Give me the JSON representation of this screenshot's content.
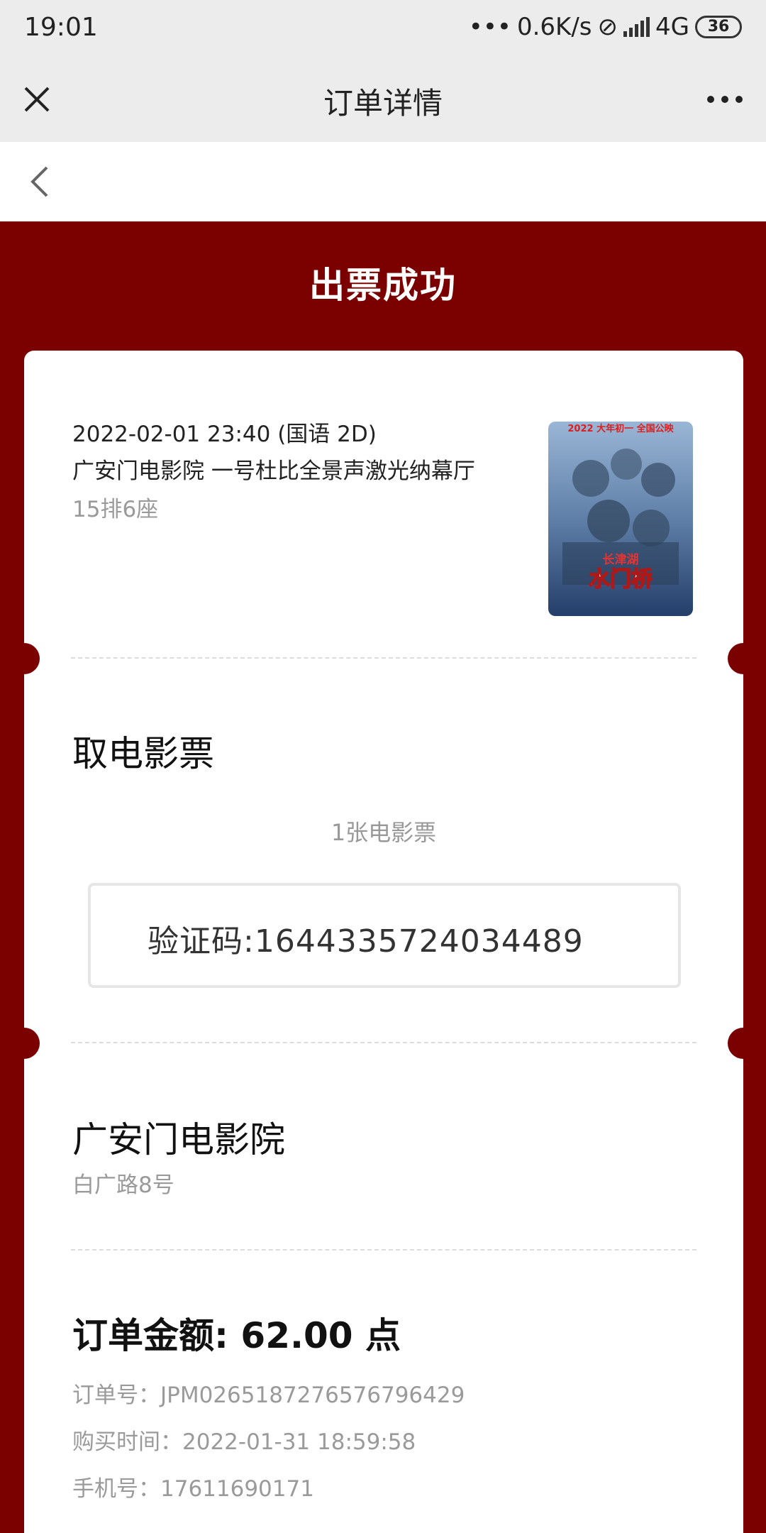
{
  "status_bar": {
    "time": "19:01",
    "network_speed": "0.6K/s",
    "network_type": "4G",
    "battery": "36"
  },
  "title_bar": {
    "title": "订单详情",
    "close_icon": "close-icon",
    "more_icon": "more-icon"
  },
  "nav": {
    "back_icon": "back-icon"
  },
  "order": {
    "status": "出票成功",
    "showtime": "2022-02-01 23:40 (国语 2D)",
    "cinema_hall": "广安门电影院 一号杜比全景声激光纳幕厅",
    "seat": "15排6座",
    "poster": {
      "top_text": "2022 大年初一 全国公映",
      "subtitle": "长津湖",
      "title": "水门桥"
    }
  },
  "pickup": {
    "heading": "取电影票",
    "ticket_count": "1张电影票",
    "code_label": "验证码:",
    "code": "1644335724034489"
  },
  "cinema": {
    "name": "广安门电影院",
    "address": "白广路8号"
  },
  "payment": {
    "amount_label": "订单金额",
    "amount_sep": ": ",
    "amount": "62.00",
    "unit": "点",
    "order_no_label": "订单号：",
    "order_no": "JPM0265187276576796429",
    "purchase_time_label": "购买时间：",
    "purchase_time": "2022-01-31 18:59:58",
    "phone_label": "手机号：",
    "phone": "17611690171"
  },
  "colors": {
    "brand": "#7b0000",
    "card": "#ffffff",
    "muted": "#9a9a9a"
  }
}
